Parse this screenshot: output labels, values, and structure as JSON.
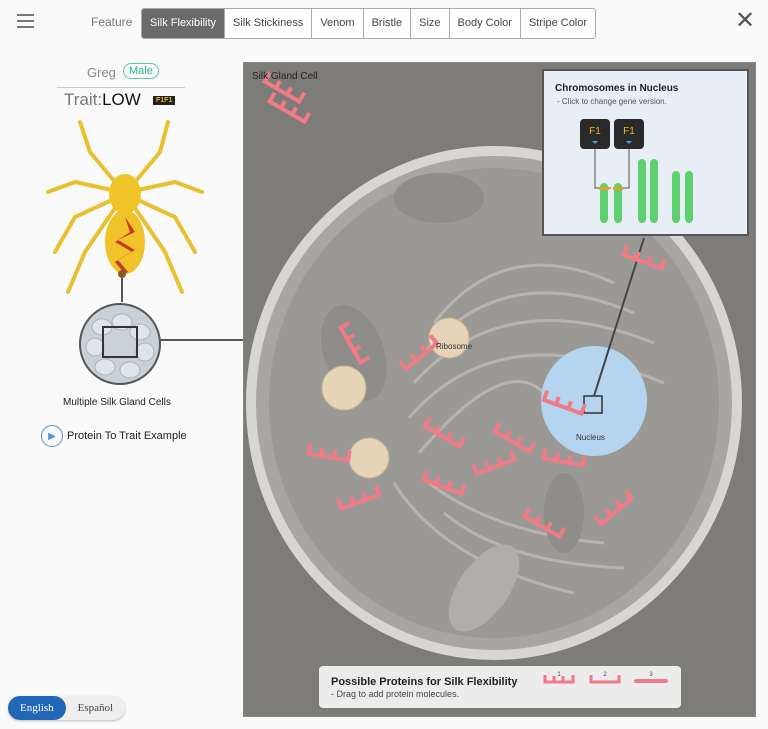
{
  "header": {
    "feature_label": "Feature",
    "tabs": [
      "Silk Flexibility",
      "Silk Stickiness",
      "Venom",
      "Bristle",
      "Size",
      "Body Color",
      "Stripe Color"
    ],
    "active_tab": 0,
    "close": "✕"
  },
  "organism": {
    "name": "Greg",
    "sex": "Male",
    "trait_label": "Trait:",
    "trait_value": "LOW",
    "genotype": "F1F1",
    "cells_label": "Multiple Silk Gland Cells",
    "example_link": "Protein To Trait Example"
  },
  "cell": {
    "title": "Silk Gland Cell",
    "ribosome": "Ribosome",
    "nucleus": "Nucleus"
  },
  "chromosomes": {
    "title": "Chromosomes in Nucleus",
    "hint": "- Click to change gene version.",
    "genes": [
      "F1",
      "F1"
    ]
  },
  "proteins": {
    "title": "Possible Proteins for Silk Flexibility",
    "hint": "- Drag to add protein molecules.",
    "options": [
      "1",
      "2",
      "3"
    ]
  },
  "language": {
    "english": "English",
    "spanish": "Español"
  },
  "colors": {
    "protein": "#f07a88",
    "accent": "#2266b8",
    "sex": "#2bb58a"
  }
}
